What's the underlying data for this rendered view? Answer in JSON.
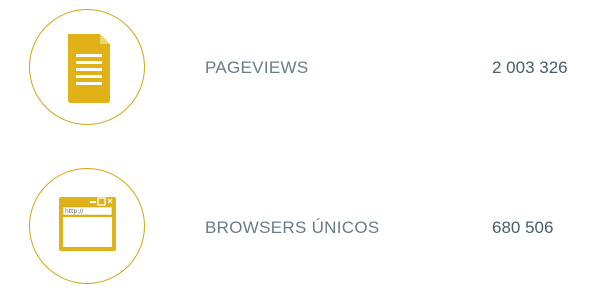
{
  "stats": [
    {
      "label": "PAGEVIEWS",
      "value": "2 003 326",
      "icon": "document-icon"
    },
    {
      "label": "BROWSERS ÚNICOS",
      "value": "680 506",
      "icon": "browser-window-icon",
      "icon_text": "http://"
    }
  ],
  "colors": {
    "accent": "#d4a514",
    "accent_fill": "#e0b218",
    "label": "#6b7b85",
    "value": "#4a5d68"
  }
}
